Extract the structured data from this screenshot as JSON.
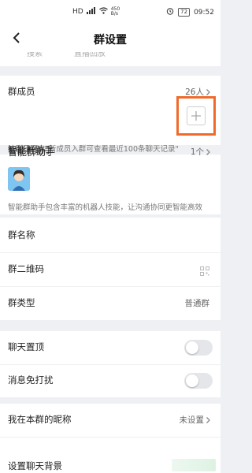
{
  "status_bar": {
    "network": "HD",
    "net_speed_value": "450",
    "net_speed_unit": "B/s",
    "battery": "72",
    "time": "09:52"
  },
  "header": {
    "title": "群设置"
  },
  "partial_row": {
    "item1": "搜索",
    "item2": "直播回放"
  },
  "members": {
    "label": "群成员",
    "count": "26人"
  },
  "member_hint": "该群已开启\"新成员入群可查看最近100条聊天记录\"",
  "assistant": {
    "label": "智能群助手",
    "count": "1个"
  },
  "assistant_hint": "智能群助手包含丰富的机器人技能，让沟通协同更智能高效",
  "settings": {
    "group_name": "群名称",
    "qr_code": "群二维码",
    "group_type_label": "群类型",
    "group_type_value": "普通群"
  },
  "toggles": {
    "pin_chat": "聊天置顶",
    "mute": "消息免打扰"
  },
  "nickname": {
    "label": "我在本群的昵称",
    "value": "未设置"
  },
  "background": {
    "label": "设置聊天背景"
  },
  "colors": {
    "accent_highlight": "#f06a2b",
    "page_bg": "#eef0f3"
  }
}
